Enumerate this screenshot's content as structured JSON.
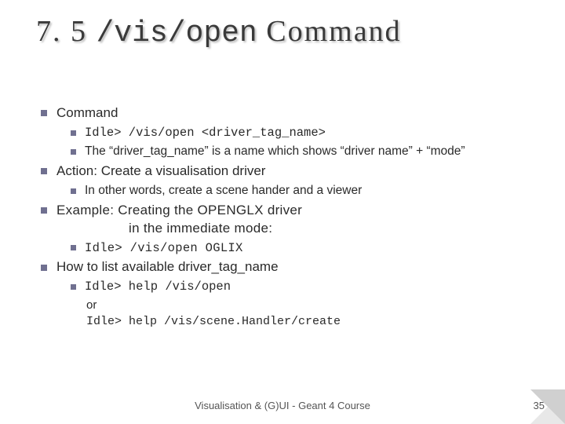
{
  "title": {
    "num": "7. 5",
    "code": "/vis/open",
    "word": "Command"
  },
  "items": {
    "command_heading": "Command",
    "cmd_idle": "Idle> /vis/open <driver_tag_name>",
    "cmd_desc": "The “driver_tag_name” is a name which shows “driver name” + “mode”",
    "action": "Action: Create a visualisation driver",
    "action_sub": "In other words, create a scene hander and a viewer",
    "example_l1": "Example: Creating the OPENGLX driver",
    "example_l2": "in the immediate mode:",
    "example_cmd": "Idle> /vis/open OGLIX",
    "howto": "How to list available driver_tag_name",
    "howto_cmd1": "Idle> help /vis/open",
    "or": "or",
    "howto_cmd2": "Idle> help /vis/scene.Handler/create"
  },
  "footer": {
    "text": "Visualisation & (G)UI - Geant 4 Course",
    "page": "35"
  }
}
